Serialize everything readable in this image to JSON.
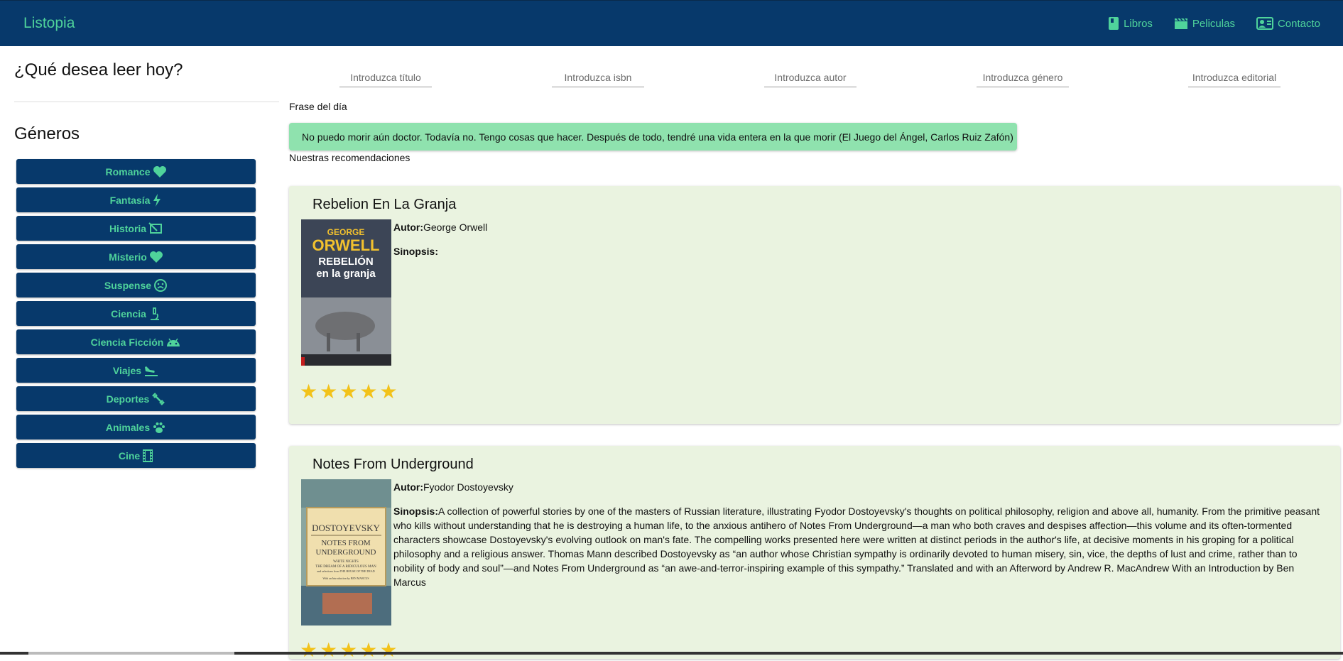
{
  "app": {
    "brand": "Listopia"
  },
  "nav": [
    {
      "label": "Libros",
      "icon": "book-icon"
    },
    {
      "label": "Peliculas",
      "icon": "clapperboard-icon"
    },
    {
      "label": "Contacto",
      "icon": "contact-card-icon"
    }
  ],
  "sidebar": {
    "question": "¿Qué desea leer hoy?",
    "genres_title": "Géneros",
    "genres": [
      {
        "label": "Romance",
        "icon": "heart-icon"
      },
      {
        "label": "Fantasía",
        "icon": "bolt-icon"
      },
      {
        "label": "Historia",
        "icon": "history-icon"
      },
      {
        "label": "Misterio",
        "icon": "heart-icon"
      },
      {
        "label": "Suspense",
        "icon": "sad-face-icon"
      },
      {
        "label": "Ciencia",
        "icon": "microscope-icon"
      },
      {
        "label": "Ciencia Ficción",
        "icon": "android-icon"
      },
      {
        "label": "Viajes",
        "icon": "plane-landing-icon"
      },
      {
        "label": "Deportes",
        "icon": "dumbbell-icon"
      },
      {
        "label": "Animales",
        "icon": "paw-icon"
      },
      {
        "label": "Cine",
        "icon": "film-icon"
      }
    ]
  },
  "search": {
    "title_placeholder": "Introduzca título",
    "isbn_placeholder": "Introduzca isbn",
    "author_placeholder": "Introduzca autor",
    "genre_placeholder": "Introduzca género",
    "publisher_placeholder": "Introduzca editorial"
  },
  "quote": {
    "label": "Frase del día",
    "text": "No puedo morir aún doctor. Todavía no. Tengo cosas que hacer. Después de todo, tendré una vida entera en la que morir (El Juego del Ángel, Carlos Ruiz Zafón)"
  },
  "recommendations": {
    "label": "Nuestras recomendaciones",
    "author_label": "Autor:",
    "synopsis_label": "Sinopsis:",
    "books": [
      {
        "title": "Rebelion En La Granja",
        "author": "George Orwell",
        "synopsis": "",
        "rating": 5,
        "cover_lines": [
          "GEORGE",
          "ORWELL",
          "REBELIÓN",
          "en la granja"
        ]
      },
      {
        "title": "Notes From Underground",
        "author": "Fyodor Dostoyevsky",
        "synopsis": "A collection of powerful stories by one of the masters of Russian literature, illustrating Fyodor Dostoyevsky's thoughts on political philosophy, religion and above all, humanity. From the primitive peasant who kills without understanding that he is destroying a human life, to the anxious antihero of Notes From Underground—a man who both craves and despises affection—this volume and its often-tormented characters showcase Dostoyevsky's evolving outlook on man's fate. The compelling works presented here were written at distinct periods in the author's life, at decisive moments in his groping for a political philosophy and a religious answer. Thomas Mann described Dostoyevsky as “an author whose Christian sympathy is ordinarily devoted to human misery, sin, vice, the depths of lust and crime, rather than to nobility of body and soul”—and Notes From Underground as “an awe-and-terror-inspiring example of this sympathy.” Translated and with an Afterword by Andrew R. MacAndrew With an Introduction by Ben Marcus",
        "rating": 5,
        "cover_lines": [
          "DOSTOYEVSKY",
          "NOTES FROM",
          "UNDERGROUND",
          "WHITE NIGHTS",
          "THE DREAM OF A RIDICULOUS MAN",
          "and selections from THE HOUSE OF THE DEAD",
          "With an Introduction by BEN MARCUS"
        ]
      }
    ]
  },
  "colors": {
    "navy": "#07396b",
    "accent_green": "#4fd39b",
    "quote_bg": "#8fe2ae",
    "card_bg": "#eaf3e0",
    "star": "#f2c21a"
  }
}
